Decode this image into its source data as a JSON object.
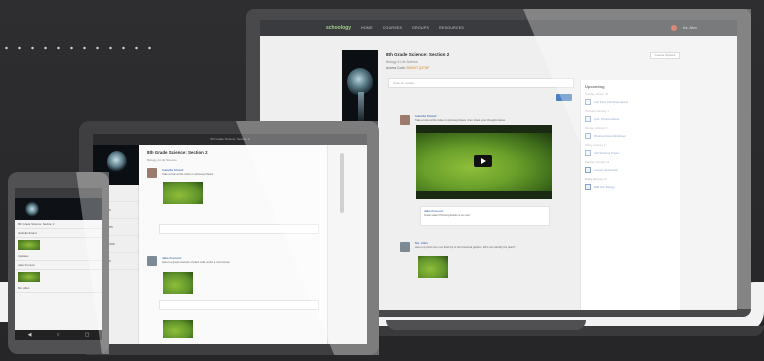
{
  "laptop": {
    "logo": "schoology",
    "nav": [
      "HOME",
      "COURSES",
      "GROUPS",
      "RESOURCES"
    ],
    "user": "Ms. Allen",
    "group": {
      "title": "8th Grade Science: Section 2",
      "subtitle": "Biology & Life Science",
      "access_label": "Access Code:",
      "access_code": "BWXKT-Q3TNP"
    },
    "settings_label": "Course Options",
    "update_placeholder": "Write an update...",
    "posts": [
      {
        "author": "Isabella Strand",
        "text": "Take a look at this video on photosynthesis, then share your thoughts below."
      },
      {
        "author": "Jake Frenson",
        "text": "Great video! Photosynthesis is so cool."
      },
      {
        "author": "Ms. Allen",
        "text": "Here's a photo from our field trip to the botanical garden. Who can identify the plant?"
      }
    ],
    "upcoming": {
      "title": "Upcoming",
      "items": [
        {
          "date": "Tuesday, January 30",
          "label": "Lab: Plant Cell Observations"
        },
        {
          "date": "Thursday, February 1",
          "label": "Quiz: Photosynthesis"
        },
        {
          "date": "Monday, February 5",
          "label": "Photosynthesis Worksheet"
        },
        {
          "date": "Friday, February 9",
          "label": "Cell Structure Project"
        },
        {
          "date": "Tuesday, February 13",
          "label": "Lecture: Respiration"
        },
        {
          "date": "Friday, February 16",
          "label": "Unit Test: Biology"
        }
      ]
    }
  },
  "tablet": {
    "header": "8th Grade Science: Section 2",
    "title": "8th Grade Science: Section 2",
    "subtitle": "Biology & Life Science",
    "sidebar": [
      "Updates",
      "Members",
      "Resources",
      "Discussions",
      "Members"
    ],
    "posts": [
      {
        "author": "Isabella Strand",
        "text": "Take a look at this video on photosynthesis."
      },
      {
        "author": "Jake Frenson",
        "text": "Here's a great example of plant cells under a microscope."
      }
    ]
  },
  "phone": {
    "header": "Groups",
    "title": "8th Grade Science: Section 2",
    "lines": [
      "Isabella Strand",
      "Updates",
      "Jake Frenson",
      "Ms. Allen"
    ]
  }
}
